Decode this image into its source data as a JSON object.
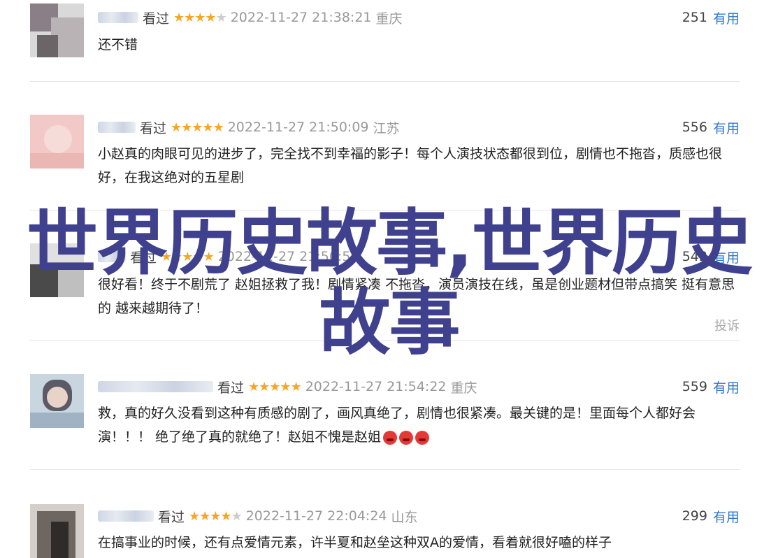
{
  "overlay_title": "世界历史故事,世界历史故事",
  "useful_label": "有用",
  "report_label": "投诉",
  "reviews": [
    {
      "user": "高树叶",
      "status": "看过",
      "stars": "★★★★",
      "stars_off": "★",
      "time": "2022-11-27 21:38:21",
      "location": "重庆",
      "count": "251",
      "content": "还不错"
    },
    {
      "user": "",
      "status": "看过",
      "stars": "★★★★★",
      "stars_off": "",
      "time": "2022-11-27 21:50:09",
      "location": "江苏",
      "count": "556",
      "content": "小赵真的肉眼可见的进步了，完全找不到幸福的影子！每个人演技状态都很到位，剧情也不拖沓，质感也很好，在我这绝对的五星剧"
    },
    {
      "user": "",
      "status": "看过",
      "stars": "★★★★★",
      "stars_off": "",
      "time": "2022-11-27 21:50:52",
      "location": "",
      "count": "543",
      "content": "很好看！终于不剧荒了 赵姐拯救了我！剧情紧凑 不拖沓，演员演技在线，虽是创业题材但带点搞笑 挺有意思的 越来越期待了！"
    },
    {
      "user": "",
      "status": "看过",
      "stars": "★★★★★",
      "stars_off": "",
      "time": "2022-11-27 21:54:22",
      "location": "重庆",
      "count": "559",
      "content": "救，真的好久没看到这种有质感的剧了，画风真绝了，剧情也很紧凑。最关键的是！里面每个人都好会演！！！ 绝了绝了真的就绝了！赵姐不愧是赵姐"
    },
    {
      "user": "",
      "status": "看过",
      "stars": "★★★★",
      "stars_off": "★",
      "time": "2022-11-27 22:04:24",
      "location": "山东",
      "count": "299",
      "content": "在搞事业的时候，还有点爱情元素，许半夏和赵垒这种双A的爱情，看着就很好嗑的样子"
    }
  ]
}
